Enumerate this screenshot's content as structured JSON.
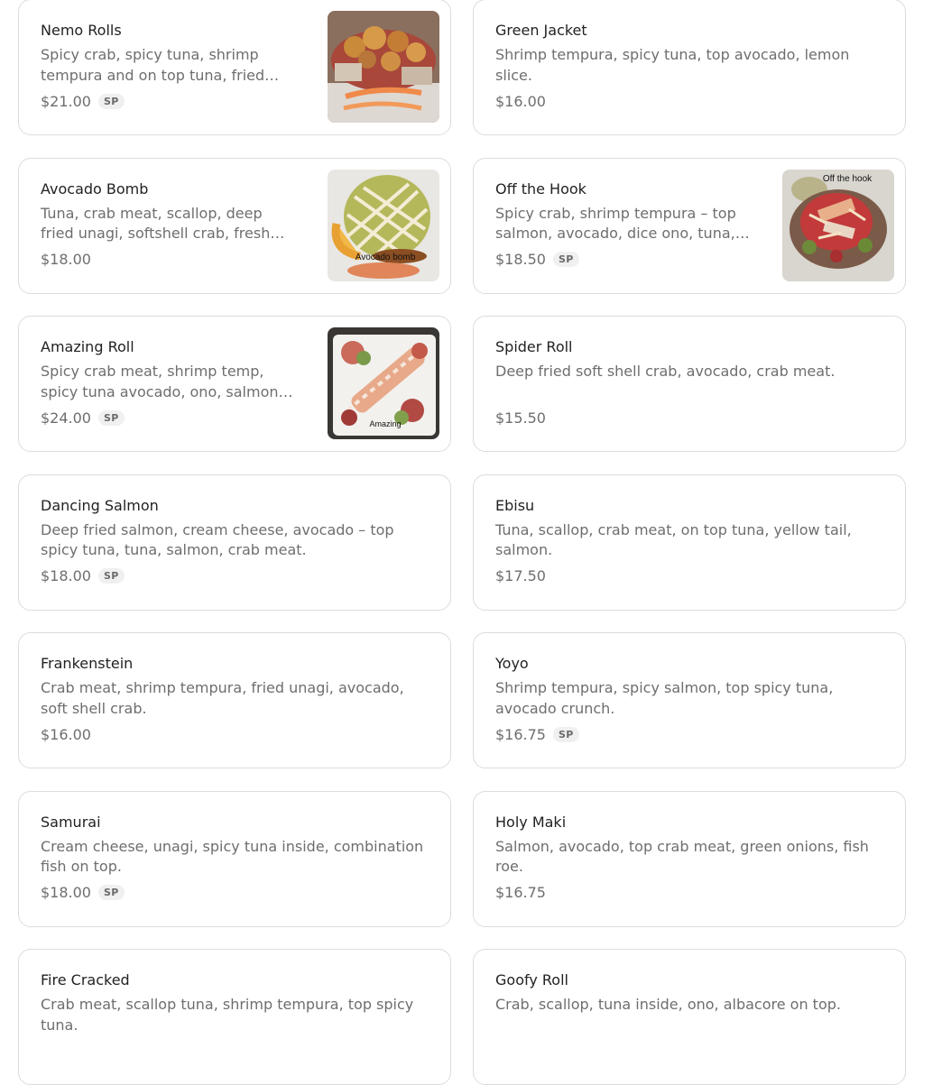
{
  "menu_items": [
    {
      "name": "Nemo Rolls",
      "description": "Spicy crab, spicy tuna, shrimp tempura and on top tuna, fried…",
      "price": "$21.00",
      "badge": "SP",
      "image": "nemo"
    },
    {
      "name": "Green Jacket",
      "description": "Shrimp tempura, spicy tuna, top avocado, lemon slice.",
      "price": "$16.00",
      "badge": "",
      "image": ""
    },
    {
      "name": "Avocado Bomb",
      "description": "Tuna, crab meat, scallop, deep fried unagi, softshell crab, fresh…",
      "price": "$18.00",
      "badge": "",
      "image": "avocado",
      "image_caption": "Avocado bomb"
    },
    {
      "name": "Off the Hook",
      "description": "Spicy crab, shrimp tempura – top salmon, avocado, dice ono, tuna,…",
      "price": "$18.50",
      "badge": "SP",
      "image": "hook",
      "image_caption": "Off the hook"
    },
    {
      "name": "Amazing Roll",
      "description": "Spicy crab meat, shrimp temp, spicy tuna avocado, ono, salmon…",
      "price": "$24.00",
      "badge": "SP",
      "image": "amazing",
      "image_caption": "Amazing"
    },
    {
      "name": "Spider Roll",
      "description": "Deep fried soft shell crab, avocado, crab meat.",
      "price": "$15.50",
      "badge": "",
      "image": ""
    },
    {
      "name": "Dancing Salmon",
      "description": "Deep fried salmon, cream cheese, avocado – top spicy tuna, tuna, salmon, crab meat.",
      "price": "$18.00",
      "badge": "SP",
      "image": ""
    },
    {
      "name": "Ebisu",
      "description": "Tuna, scallop, crab meat, on top tuna, yellow tail, salmon.",
      "price": "$17.50",
      "badge": "",
      "image": ""
    },
    {
      "name": "Frankenstein",
      "description": "Crab meat, shrimp tempura, fried unagi, avocado, soft shell crab.",
      "price": "$16.00",
      "badge": "",
      "image": ""
    },
    {
      "name": "Yoyo",
      "description": "Shrimp tempura, spicy salmon, top spicy tuna, avocado crunch.",
      "price": "$16.75",
      "badge": "SP",
      "image": ""
    },
    {
      "name": "Samurai",
      "description": "Cream cheese, unagi, spicy tuna inside, combination fish on top.",
      "price": "$18.00",
      "badge": "SP",
      "image": ""
    },
    {
      "name": "Holy Maki",
      "description": "Salmon, avocado, top crab meat, green onions, fish roe.",
      "price": "$16.75",
      "badge": "",
      "image": ""
    },
    {
      "name": "Fire Cracked",
      "description": "Crab meat, scallop tuna, shrimp tempura, top spicy tuna.",
      "price": "",
      "badge": "",
      "image": ""
    },
    {
      "name": "Goofy Roll",
      "description": "Crab, scallop, tuna inside, ono, albacore on top.",
      "price": "",
      "badge": "",
      "image": ""
    }
  ]
}
